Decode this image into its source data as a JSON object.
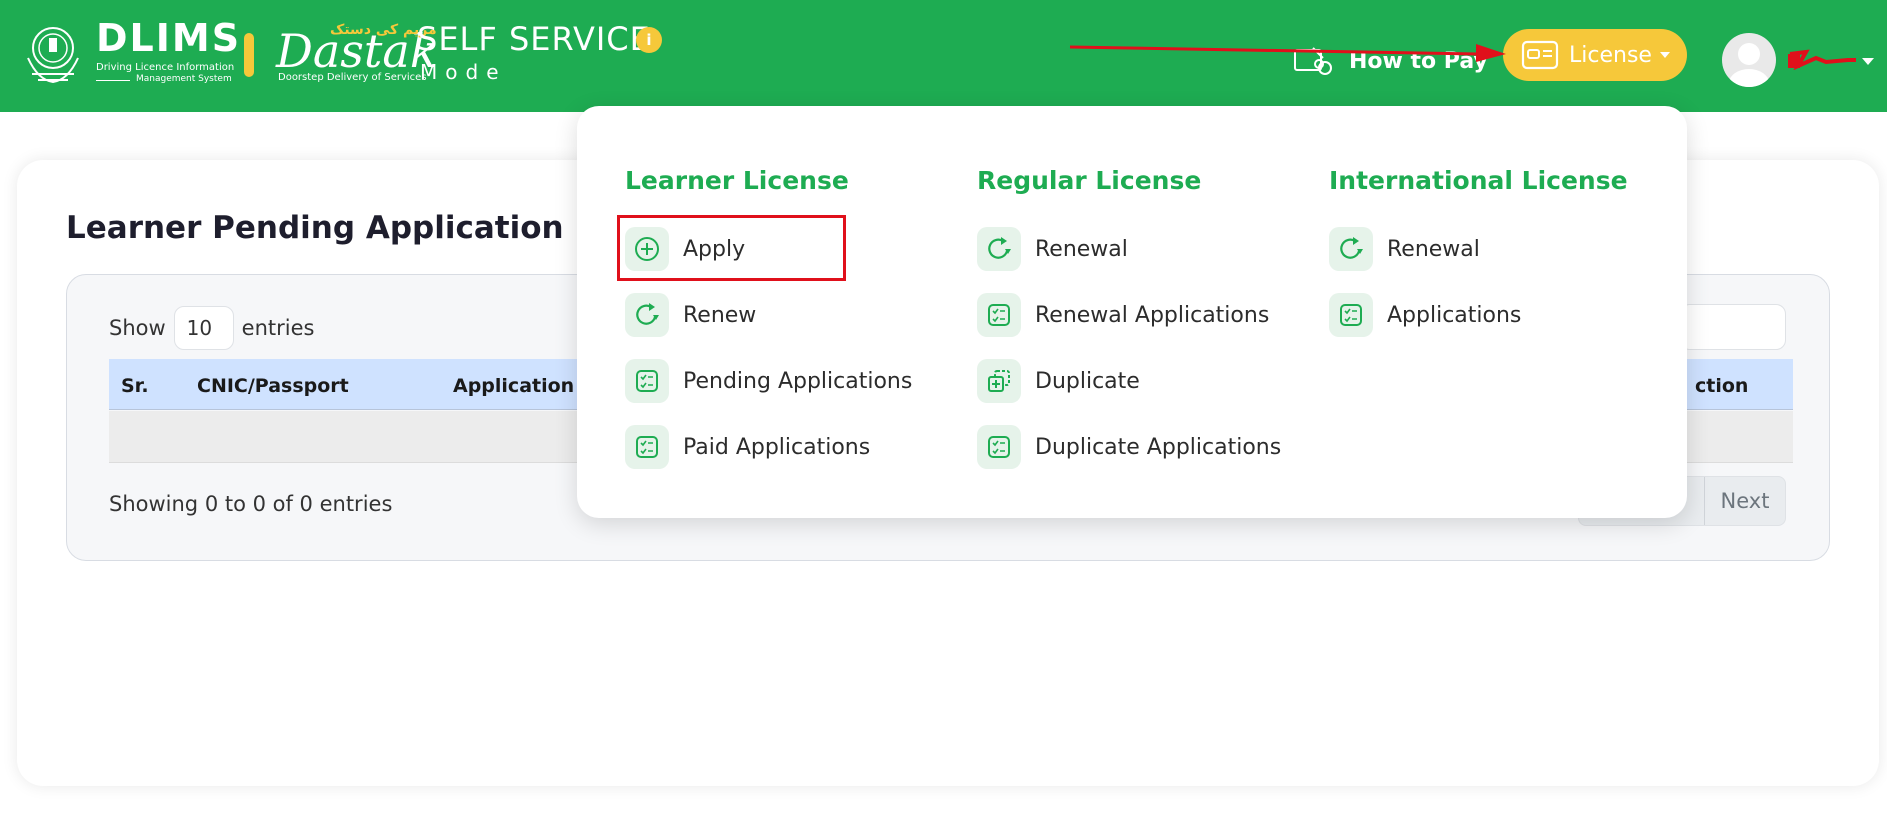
{
  "header": {
    "dlims_title": "DLIMS",
    "dlims_sub1": "Driving Licence Information",
    "dlims_sub2": "Management System",
    "dastak_urdu": "مریم کی دستک",
    "dastak_word": "Dastak",
    "dastak_sub": "Doorstep Delivery of Services",
    "self_service": "SELF SERVICE",
    "mode": "Mode",
    "info_glyph": "i",
    "how_to_pay": "How to Pay",
    "license_label": "License",
    "brand_color": "#1eac52",
    "accent_color": "#f6c83a",
    "icons": [
      "emblem-icon",
      "info-icon",
      "how-to-pay-icon",
      "license-card-icon",
      "caret-down-icon",
      "avatar-icon"
    ]
  },
  "main": {
    "title": "Learner Pending Application",
    "show_label": "Show",
    "show_value": "10",
    "entries_label": "entries",
    "columns": [
      "Sr.",
      "CNIC/Passport",
      "Application Ty",
      "ction"
    ],
    "showing_text": "Showing 0 to 0 of 0 entries",
    "next_label": "Next"
  },
  "dropdown": {
    "learner": {
      "heading": "Learner License",
      "items": [
        "Apply",
        "Renew",
        "Pending Applications",
        "Paid Applications"
      ]
    },
    "regular": {
      "heading": "Regular License",
      "items": [
        "Renewal",
        "Renewal Applications",
        "Duplicate",
        "Duplicate Applications"
      ]
    },
    "international": {
      "heading": "International License",
      "items": [
        "Renewal",
        "Applications"
      ]
    }
  },
  "annotation": {
    "highlight_color": "#e0101b"
  }
}
